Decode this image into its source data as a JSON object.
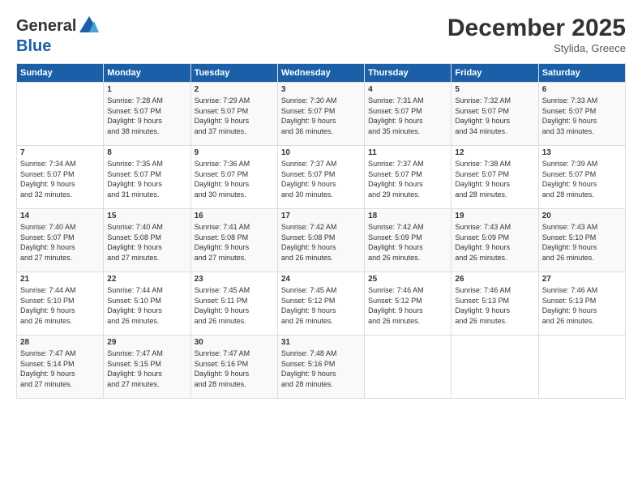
{
  "header": {
    "logo_general": "General",
    "logo_blue": "Blue",
    "month": "December 2025",
    "location": "Stylida, Greece"
  },
  "days_of_week": [
    "Sunday",
    "Monday",
    "Tuesday",
    "Wednesday",
    "Thursday",
    "Friday",
    "Saturday"
  ],
  "weeks": [
    [
      {
        "num": "",
        "info": ""
      },
      {
        "num": "1",
        "info": "Sunrise: 7:28 AM\nSunset: 5:07 PM\nDaylight: 9 hours\nand 38 minutes."
      },
      {
        "num": "2",
        "info": "Sunrise: 7:29 AM\nSunset: 5:07 PM\nDaylight: 9 hours\nand 37 minutes."
      },
      {
        "num": "3",
        "info": "Sunrise: 7:30 AM\nSunset: 5:07 PM\nDaylight: 9 hours\nand 36 minutes."
      },
      {
        "num": "4",
        "info": "Sunrise: 7:31 AM\nSunset: 5:07 PM\nDaylight: 9 hours\nand 35 minutes."
      },
      {
        "num": "5",
        "info": "Sunrise: 7:32 AM\nSunset: 5:07 PM\nDaylight: 9 hours\nand 34 minutes."
      },
      {
        "num": "6",
        "info": "Sunrise: 7:33 AM\nSunset: 5:07 PM\nDaylight: 9 hours\nand 33 minutes."
      }
    ],
    [
      {
        "num": "7",
        "info": "Sunrise: 7:34 AM\nSunset: 5:07 PM\nDaylight: 9 hours\nand 32 minutes."
      },
      {
        "num": "8",
        "info": "Sunrise: 7:35 AM\nSunset: 5:07 PM\nDaylight: 9 hours\nand 31 minutes."
      },
      {
        "num": "9",
        "info": "Sunrise: 7:36 AM\nSunset: 5:07 PM\nDaylight: 9 hours\nand 30 minutes."
      },
      {
        "num": "10",
        "info": "Sunrise: 7:37 AM\nSunset: 5:07 PM\nDaylight: 9 hours\nand 30 minutes."
      },
      {
        "num": "11",
        "info": "Sunrise: 7:37 AM\nSunset: 5:07 PM\nDaylight: 9 hours\nand 29 minutes."
      },
      {
        "num": "12",
        "info": "Sunrise: 7:38 AM\nSunset: 5:07 PM\nDaylight: 9 hours\nand 28 minutes."
      },
      {
        "num": "13",
        "info": "Sunrise: 7:39 AM\nSunset: 5:07 PM\nDaylight: 9 hours\nand 28 minutes."
      }
    ],
    [
      {
        "num": "14",
        "info": "Sunrise: 7:40 AM\nSunset: 5:07 PM\nDaylight: 9 hours\nand 27 minutes."
      },
      {
        "num": "15",
        "info": "Sunrise: 7:40 AM\nSunset: 5:08 PM\nDaylight: 9 hours\nand 27 minutes."
      },
      {
        "num": "16",
        "info": "Sunrise: 7:41 AM\nSunset: 5:08 PM\nDaylight: 9 hours\nand 27 minutes."
      },
      {
        "num": "17",
        "info": "Sunrise: 7:42 AM\nSunset: 5:08 PM\nDaylight: 9 hours\nand 26 minutes."
      },
      {
        "num": "18",
        "info": "Sunrise: 7:42 AM\nSunset: 5:09 PM\nDaylight: 9 hours\nand 26 minutes."
      },
      {
        "num": "19",
        "info": "Sunrise: 7:43 AM\nSunset: 5:09 PM\nDaylight: 9 hours\nand 26 minutes."
      },
      {
        "num": "20",
        "info": "Sunrise: 7:43 AM\nSunset: 5:10 PM\nDaylight: 9 hours\nand 26 minutes."
      }
    ],
    [
      {
        "num": "21",
        "info": "Sunrise: 7:44 AM\nSunset: 5:10 PM\nDaylight: 9 hours\nand 26 minutes."
      },
      {
        "num": "22",
        "info": "Sunrise: 7:44 AM\nSunset: 5:10 PM\nDaylight: 9 hours\nand 26 minutes."
      },
      {
        "num": "23",
        "info": "Sunrise: 7:45 AM\nSunset: 5:11 PM\nDaylight: 9 hours\nand 26 minutes."
      },
      {
        "num": "24",
        "info": "Sunrise: 7:45 AM\nSunset: 5:12 PM\nDaylight: 9 hours\nand 26 minutes."
      },
      {
        "num": "25",
        "info": "Sunrise: 7:46 AM\nSunset: 5:12 PM\nDaylight: 9 hours\nand 26 minutes."
      },
      {
        "num": "26",
        "info": "Sunrise: 7:46 AM\nSunset: 5:13 PM\nDaylight: 9 hours\nand 26 minutes."
      },
      {
        "num": "27",
        "info": "Sunrise: 7:46 AM\nSunset: 5:13 PM\nDaylight: 9 hours\nand 26 minutes."
      }
    ],
    [
      {
        "num": "28",
        "info": "Sunrise: 7:47 AM\nSunset: 5:14 PM\nDaylight: 9 hours\nand 27 minutes."
      },
      {
        "num": "29",
        "info": "Sunrise: 7:47 AM\nSunset: 5:15 PM\nDaylight: 9 hours\nand 27 minutes."
      },
      {
        "num": "30",
        "info": "Sunrise: 7:47 AM\nSunset: 5:16 PM\nDaylight: 9 hours\nand 28 minutes."
      },
      {
        "num": "31",
        "info": "Sunrise: 7:48 AM\nSunset: 5:16 PM\nDaylight: 9 hours\nand 28 minutes."
      },
      {
        "num": "",
        "info": ""
      },
      {
        "num": "",
        "info": ""
      },
      {
        "num": "",
        "info": ""
      }
    ]
  ]
}
